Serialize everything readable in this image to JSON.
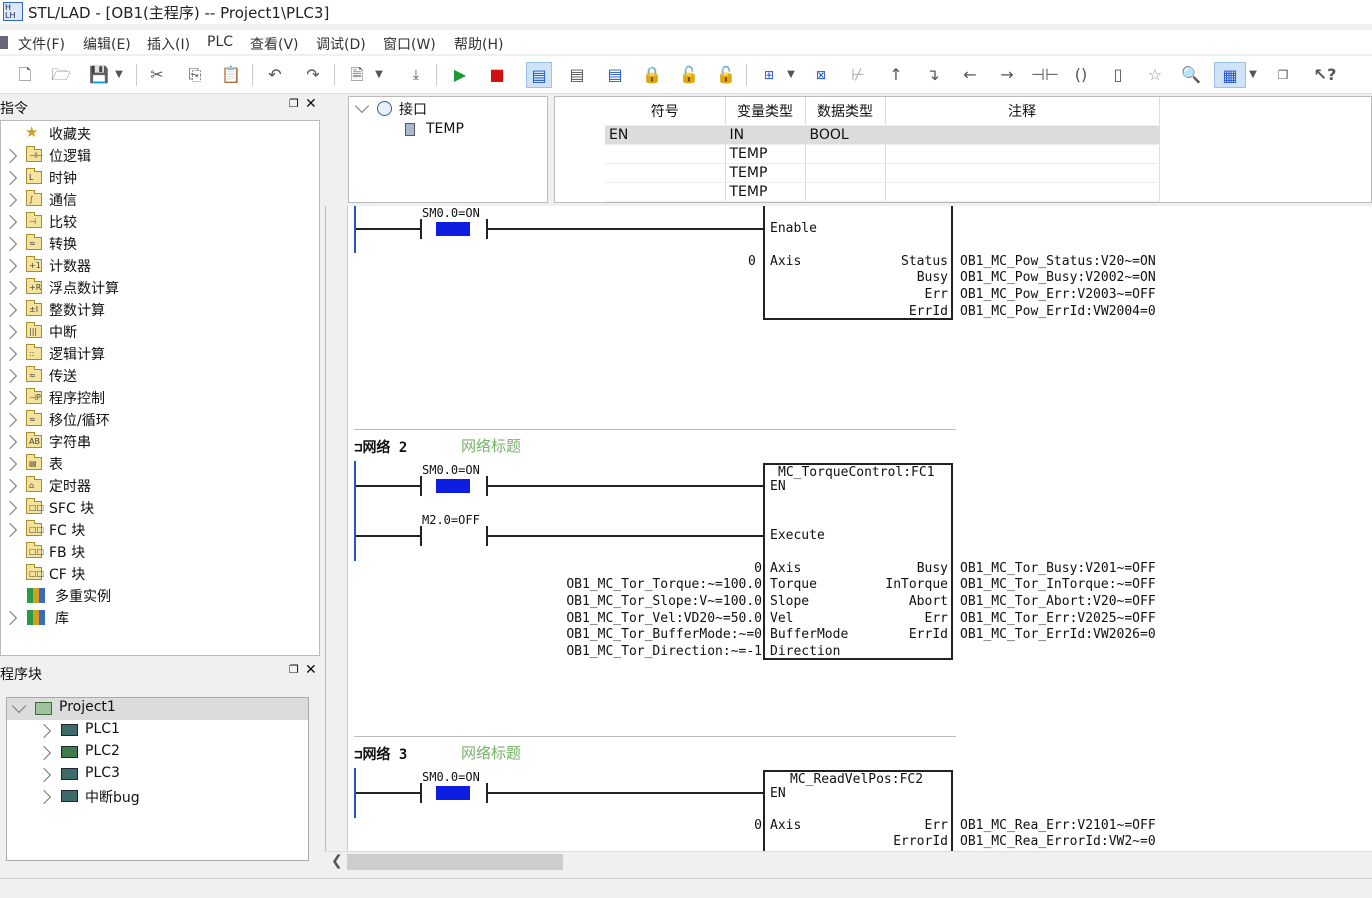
{
  "window": {
    "title": "STL/LAD - [OB1(主程序) -- Project1\\PLC3]"
  },
  "menu": [
    "文件(F)",
    "编辑(E)",
    "插入(I)",
    "PLC",
    "查看(V)",
    "调试(D)",
    "窗口(W)",
    "帮助(H)"
  ],
  "toolbar": {
    "icons": [
      "new-file-icon",
      "open-folder-icon",
      "save-icon",
      "dropdown-arrow-icon",
      "cut-icon",
      "copy-icon",
      "paste-icon",
      "undo-icon",
      "redo-icon",
      "document-icon",
      "dropdown-arrow-icon",
      "download-icon",
      "run-icon",
      "stop-icon",
      "network-view-icon",
      "network-view-icon",
      "network-view-icon",
      "lock-icon",
      "unlock-icon",
      "unlock-icon",
      "insert-network-icon",
      "dropdown-arrow-icon",
      "delete-network-icon",
      "negate-icon",
      "branch-up-icon",
      "branch-down-icon",
      "line-left-icon",
      "line-right-icon",
      "contact-icon",
      "coil-icon",
      "box-icon",
      "favorite-star-icon",
      "zoom-icon",
      "table-view-icon",
      "dropdown-arrow-icon",
      "restore-window-icon",
      "context-help-icon"
    ]
  },
  "instr_panel": {
    "title": "指令",
    "items": [
      {
        "label": "收藏夹",
        "icon": "star-icon",
        "expandable": false
      },
      {
        "label": "位逻辑",
        "icon": "folder-icon",
        "glyph": "⊣⊢",
        "expandable": true
      },
      {
        "label": "时钟",
        "icon": "folder-icon",
        "glyph": "L",
        "expandable": true
      },
      {
        "label": "通信",
        "icon": "folder-icon",
        "glyph": "∫",
        "expandable": true
      },
      {
        "label": "比较",
        "icon": "folder-icon",
        "glyph": "⊣",
        "expandable": true
      },
      {
        "label": "转换",
        "icon": "folder-icon",
        "glyph": "≈",
        "expandable": true
      },
      {
        "label": "计数器",
        "icon": "folder-icon",
        "glyph": "+1",
        "expandable": true
      },
      {
        "label": "浮点数计算",
        "icon": "folder-icon",
        "glyph": "+R",
        "expandable": true
      },
      {
        "label": "整数计算",
        "icon": "folder-icon",
        "glyph": "±I",
        "expandable": true
      },
      {
        "label": "中断",
        "icon": "folder-icon",
        "glyph": "|||",
        "expandable": true
      },
      {
        "label": "逻辑计算",
        "icon": "folder-icon",
        "glyph": "::",
        "expandable": true
      },
      {
        "label": "传送",
        "icon": "folder-icon",
        "glyph": "≈",
        "expandable": true
      },
      {
        "label": "程序控制",
        "icon": "folder-icon",
        "glyph": "⊣P",
        "expandable": true
      },
      {
        "label": "移位/循环",
        "icon": "folder-icon",
        "glyph": "≈",
        "expandable": true
      },
      {
        "label": "字符串",
        "icon": "folder-icon",
        "glyph": "AB",
        "expandable": true
      },
      {
        "label": "表",
        "icon": "folder-icon",
        "glyph": "▤",
        "expandable": true
      },
      {
        "label": "定时器",
        "icon": "folder-icon",
        "glyph": "⌂",
        "expandable": true
      },
      {
        "label": "SFC 块",
        "icon": "folder-icon",
        "glyph": "□□",
        "expandable": true
      },
      {
        "label": "FC 块",
        "icon": "folder-icon",
        "glyph": "□□",
        "expandable": true
      },
      {
        "label": "FB 块",
        "icon": "folder-icon",
        "glyph": "□□",
        "expandable": false
      },
      {
        "label": "CF 块",
        "icon": "folder-icon",
        "glyph": "□□",
        "expandable": false
      },
      {
        "label": "多重实例",
        "icon": "books-icon",
        "expandable": false
      },
      {
        "label": "库",
        "icon": "books-icon",
        "expandable": true
      }
    ]
  },
  "block_panel": {
    "title": "程序块",
    "root": "Project1",
    "children": [
      "PLC1",
      "PLC2",
      "PLC3",
      "中断bug"
    ]
  },
  "interface": {
    "root": "接口",
    "child": "TEMP"
  },
  "symtable": {
    "headers": [
      "符号",
      "变量类型",
      "数据类型",
      "注释"
    ],
    "rows": [
      {
        "sym": "EN",
        "vtype": "IN",
        "dtype": "BOOL",
        "note": ""
      },
      {
        "sym": "",
        "vtype": "TEMP",
        "dtype": "",
        "note": ""
      },
      {
        "sym": "",
        "vtype": "TEMP",
        "dtype": "",
        "note": ""
      },
      {
        "sym": "",
        "vtype": "TEMP",
        "dtype": "",
        "note": ""
      }
    ]
  },
  "ladder": {
    "net1": {
      "contact": "SM0.0=ON",
      "box": {
        "inputs": [
          {
            "name": "Enable",
            "src": ""
          },
          {
            "name": "Axis",
            "src": "0"
          }
        ],
        "outputs": [
          {
            "name": "Status",
            "dst": "OB1_MC_Pow_Status:V20~=ON"
          },
          {
            "name": "Busy",
            "dst": "OB1_MC_Pow_Busy:V2002~=ON"
          },
          {
            "name": "Err",
            "dst": "OB1_MC_Pow_Err:V2003~=OFF"
          },
          {
            "name": "ErrId",
            "dst": "OB1_MC_Pow_ErrId:VW2004=0"
          }
        ]
      }
    },
    "net2": {
      "title": "网络 2",
      "comment": "网络标题",
      "contact1": "SM0.0=ON",
      "contact2": "M2.0=OFF",
      "box": {
        "name": "MC_TorqueControl:FC1",
        "en": "EN",
        "execute": "Execute",
        "inputs": [
          {
            "name": "Axis",
            "src": "0"
          },
          {
            "name": "Torque",
            "src": "OB1_MC_Tor_Torque:~=100.0"
          },
          {
            "name": "Slope",
            "src": "OB1_MC_Tor_Slope:V~=100.0"
          },
          {
            "name": "Vel",
            "src": "OB1_MC_Tor_Vel:VD20~=50.0"
          },
          {
            "name": "BufferMode",
            "src": "OB1_MC_Tor_BufferMode:~=0"
          },
          {
            "name": "Direction",
            "src": "OB1_MC_Tor_Direction:~=-1"
          }
        ],
        "outputs": [
          {
            "name": "Busy",
            "dst": "OB1_MC_Tor_Busy:V201~=OFF"
          },
          {
            "name": "InTorque",
            "dst": "OB1_MC_Tor_InTorque:~=OFF"
          },
          {
            "name": "Abort",
            "dst": "OB1_MC_Tor_Abort:V20~=OFF"
          },
          {
            "name": "Err",
            "dst": "OB1_MC_Tor_Err:V2025~=OFF"
          },
          {
            "name": "ErrId",
            "dst": "OB1_MC_Tor_ErrId:VW2026=0"
          }
        ]
      }
    },
    "net3": {
      "title": "网络 3",
      "comment": "网络标题",
      "contact": "SM0.0=ON",
      "box": {
        "name": "MC_ReadVelPos:FC2",
        "en": "EN",
        "inputs": [
          {
            "name": "Axis",
            "src": "0"
          }
        ],
        "outputs": [
          {
            "name": "Err",
            "dst": "OB1_MC_Rea_Err:V2101~=OFF"
          },
          {
            "name": "ErrorId",
            "dst": "OB1_MC_Rea_ErrorId:VW2~=0"
          }
        ]
      }
    }
  },
  "colors": {
    "contact_on": "#0d1ee0",
    "rail": "#2255cc",
    "comment": "#77b26a"
  }
}
